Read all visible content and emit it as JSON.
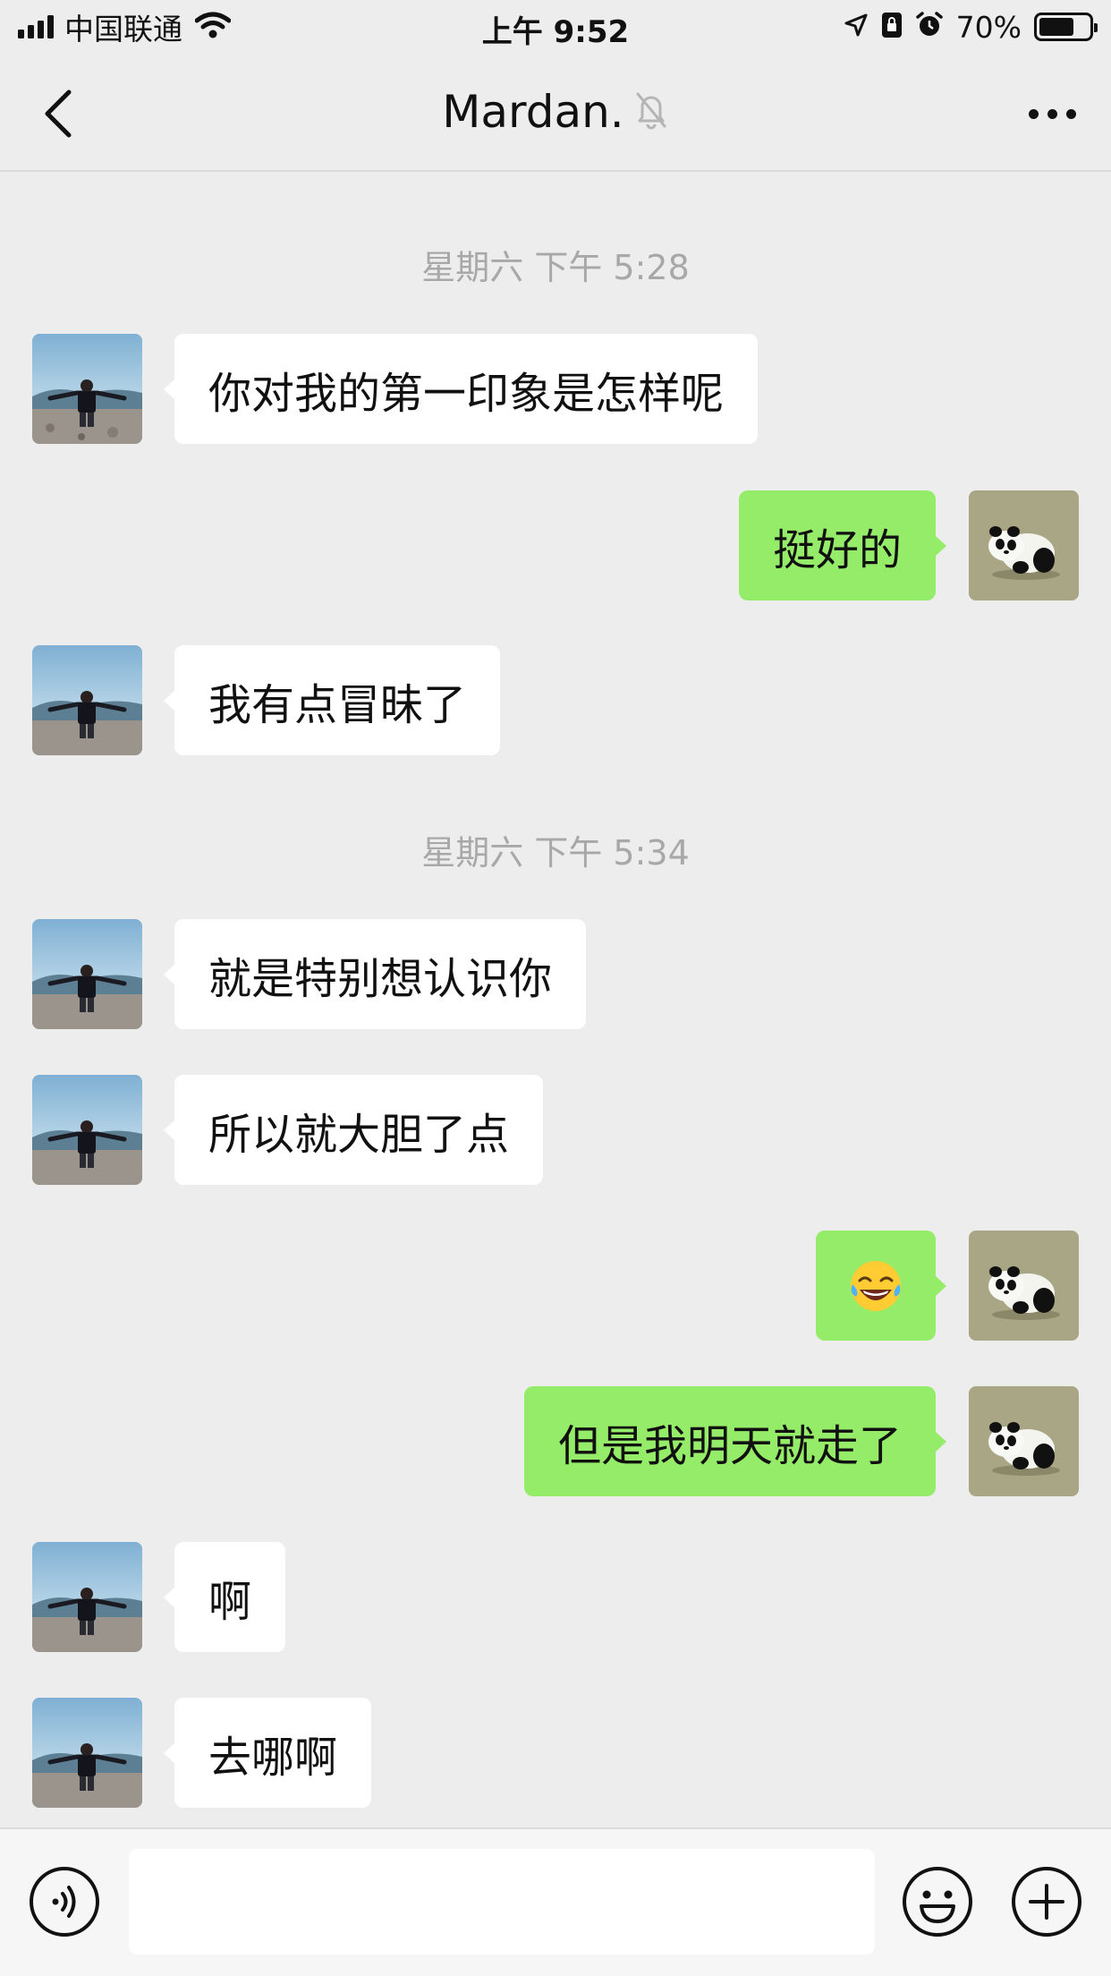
{
  "status_bar": {
    "carrier": "中国联通",
    "time": "上午 9:52",
    "battery": "70%",
    "battery_level": 0.7
  },
  "nav": {
    "title": "Mardan.",
    "muted_icon": "bell-slash-icon"
  },
  "messages": [
    {
      "type": "time",
      "text": "星期六 下午 5:28"
    },
    {
      "type": "in",
      "text": "你对我的第一印象是怎样呢"
    },
    {
      "type": "out",
      "text": "挺好的"
    },
    {
      "type": "in",
      "text": "我有点冒昧了"
    },
    {
      "type": "time",
      "text": "星期六 下午 5:34"
    },
    {
      "type": "in",
      "text": "就是特别想认识你"
    },
    {
      "type": "in",
      "text": "所以就大胆了点"
    },
    {
      "type": "out",
      "emoji": "laughing-tears-emoji",
      "text": "😂"
    },
    {
      "type": "out",
      "text": "但是我明天就走了"
    },
    {
      "type": "in",
      "text": "啊"
    },
    {
      "type": "in",
      "text": "去哪啊"
    }
  ],
  "input": {
    "placeholder": ""
  },
  "icons": {
    "voice": "voice-icon",
    "emoji": "emoji-icon",
    "add": "plus-icon"
  },
  "colors": {
    "background": "#ededed",
    "outgoing_bubble": "#95ec69",
    "incoming_bubble": "#ffffff",
    "timestamp_text": "#a8a8a8"
  }
}
